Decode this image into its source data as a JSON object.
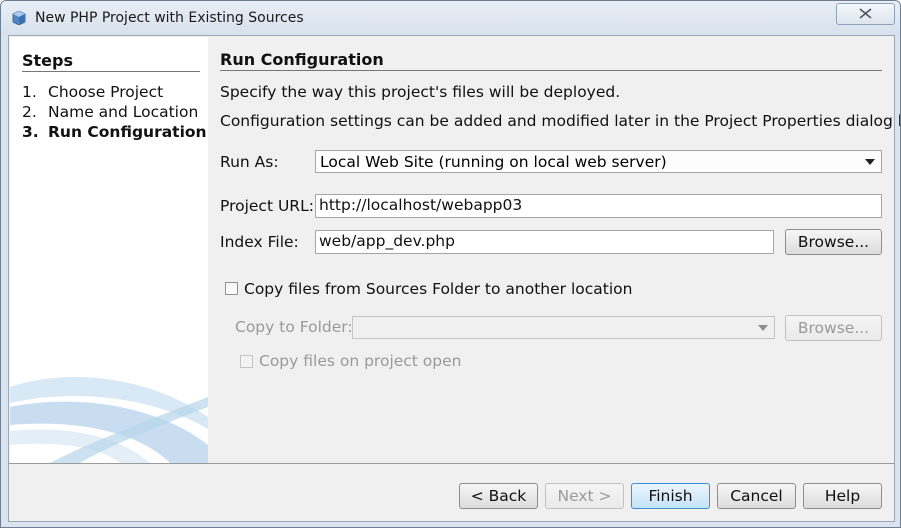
{
  "window": {
    "title": "New PHP Project with Existing Sources"
  },
  "steps": {
    "heading": "Steps",
    "items": [
      {
        "num": "1.",
        "label": "Choose Project"
      },
      {
        "num": "2.",
        "label": "Name and Location"
      },
      {
        "num": "3.",
        "label": "Run Configuration"
      }
    ]
  },
  "main": {
    "title": "Run Configuration",
    "desc1": "Specify the way this project's files will be deployed.",
    "desc2": "Configuration settings can be added and modified later in the Project Properties dialog box.",
    "run_as_label": "Run As:",
    "run_as_value": "Local Web Site (running on local web server)",
    "project_url_label": "Project URL:",
    "project_url_value": "http://localhost/webapp03",
    "index_file_label": "Index File:",
    "index_file_value": "web/app_dev.php",
    "browse_label": "Browse...",
    "copy_files_label": "Copy files from Sources Folder to another location",
    "copy_to_folder_label": "Copy to Folder:",
    "copy_to_folder_value": "",
    "copy_browse_label": "Browse...",
    "copy_on_open_label": "Copy files on project open"
  },
  "buttons": {
    "back": "< Back",
    "next": "Next >",
    "finish": "Finish",
    "cancel": "Cancel",
    "help": "Help"
  },
  "icons": {
    "app": "netbeans-cube-icon",
    "close": "close-icon",
    "dropdown": "chevron-down-icon"
  },
  "colors": {
    "accent": "#3c8fd6",
    "swoosh": "#b7d5eb"
  }
}
